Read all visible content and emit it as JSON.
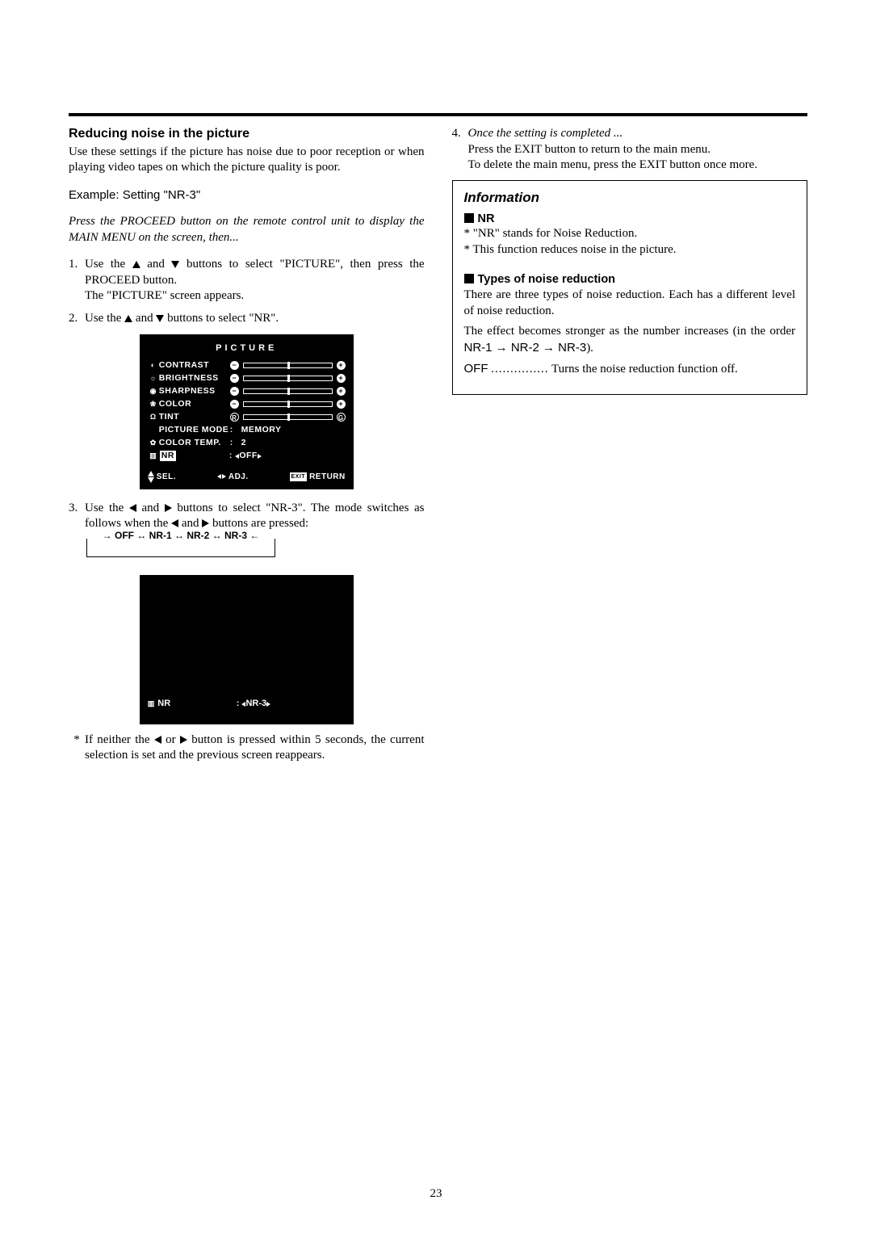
{
  "page_number": "23",
  "left": {
    "heading": "Reducing noise in the picture",
    "intro": "Use these settings if the picture has noise due to poor reception or when playing video tapes on which the picture quality is poor.",
    "example": "Example: Setting \"NR-3\"",
    "preface": "Press the PROCEED button on the remote control unit to display the MAIN MENU on the screen, then...",
    "step1a": "Use the ",
    "step1b": " and ",
    "step1c": " buttons to select \"PICTURE\", then press the PROCEED button.",
    "step1d": "The \"PICTURE\" screen appears.",
    "step2a": "Use the ",
    "step2b": " and ",
    "step2c": " buttons to select \"NR\".",
    "osd": {
      "title": "PICTURE",
      "rows": {
        "contrast": "CONTRAST",
        "brightness": "BRIGHTNESS",
        "sharpness": "SHARPNESS",
        "color": "COLOR",
        "tint": "TINT",
        "picture_mode_label": "PICTURE MODE",
        "picture_mode_value": "MEMORY",
        "color_temp_label": "COLOR TEMP.",
        "color_temp_value": "2",
        "nr_label": "NR",
        "nr_value": "OFF"
      },
      "footer": {
        "sel": "SEL.",
        "adj": "ADJ.",
        "exit": "EXIT",
        "return": "RETURN"
      }
    },
    "step3a": "Use the ",
    "step3b": " and ",
    "step3c": " buttons to select \"NR-3\". The mode switches as follows when the ",
    "step3d": " and ",
    "step3e": " buttons are pressed:",
    "cycle": "→ OFF ↔ NR-1 ↔ NR-2 ↔ NR-3 ←",
    "osd2": {
      "nr_label": "NR",
      "nr_value": "NR-3"
    },
    "note_a": "If neither the ",
    "note_b": " or ",
    "note_c": " button is pressed within 5 seconds, the current selection is set and the previous screen reappears."
  },
  "right": {
    "step4_head": "Once the setting is completed ...",
    "step4_a": "Press the EXIT button to return to the main menu.",
    "step4_b": "To delete the main menu, press the EXIT button once more.",
    "info_title": "Information",
    "nr_heading": "NR",
    "nr_line1": "* \"NR\" stands for Noise Reduction.",
    "nr_line2": "* This function reduces noise in the picture.",
    "types_heading": "Types of noise reduction",
    "types_p1": "There are three types of noise reduction. Each has a different level of noise reduction.",
    "types_p2a": "The effect becomes stronger as the number increases (in the order ",
    "types_p2b": "NR-1 → NR-2 → NR-3",
    "types_p2c": ").",
    "off_label": "OFF",
    "off_text": "Turns the noise reduction function off."
  }
}
